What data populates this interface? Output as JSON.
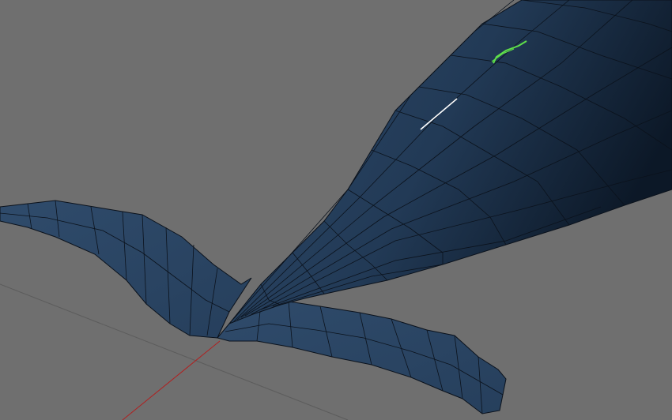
{
  "viewport": {
    "name": "3d-viewport",
    "background": "#6f6f6f",
    "mesh_fill": "#2b4563",
    "mesh_shadow": "#0d1a2a",
    "wire_color": "#0b121c",
    "selected_edge_color": "#ffffff",
    "highlight_edge_color": "#5fe04a",
    "axis_x_color": "#b02020",
    "grid_color": "#5a5a5a",
    "display_mode": "solid-with-wireframe",
    "object": "tail-fin-mesh"
  }
}
